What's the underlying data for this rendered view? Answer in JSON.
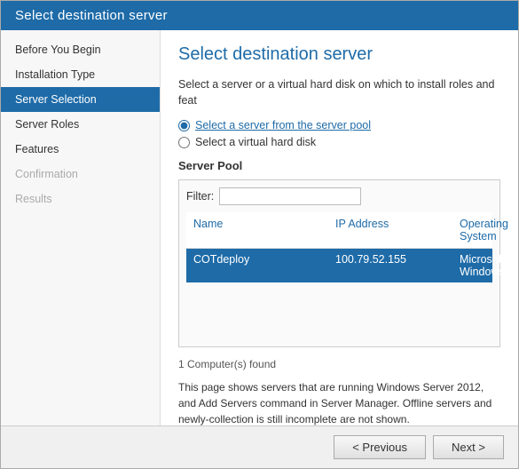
{
  "window": {
    "title": "Select destination server"
  },
  "sidebar": {
    "items": [
      {
        "label": "Before You Begin",
        "state": "normal"
      },
      {
        "label": "Installation Type",
        "state": "normal"
      },
      {
        "label": "Server Selection",
        "state": "active"
      },
      {
        "label": "Server Roles",
        "state": "normal"
      },
      {
        "label": "Features",
        "state": "normal"
      },
      {
        "label": "Confirmation",
        "state": "disabled"
      },
      {
        "label": "Results",
        "state": "disabled"
      }
    ]
  },
  "main": {
    "heading": "Select destination server",
    "description": "Select a server or a virtual hard disk on which to install roles and feat",
    "radio_options": [
      {
        "id": "r1",
        "label": "Select a server from the server pool",
        "selected": true
      },
      {
        "id": "r2",
        "label": "Select a virtual hard disk",
        "selected": false
      }
    ],
    "server_pool": {
      "title": "Server Pool",
      "filter_label": "Filter:",
      "filter_placeholder": "",
      "table": {
        "columns": [
          "Name",
          "IP Address",
          "Operating System"
        ],
        "rows": [
          {
            "name": "COTdeploy",
            "ip": "100.79.52.155",
            "os": "Microsoft Windows",
            "selected": true
          }
        ]
      }
    },
    "found_text": "1 Computer(s) found",
    "info_text": "This page shows servers that are running Windows Server 2012, and Add Servers command in Server Manager. Offline servers and newly-collection is still incomplete are not shown."
  },
  "footer": {
    "previous_label": "< Previous",
    "next_label": "Next >"
  }
}
